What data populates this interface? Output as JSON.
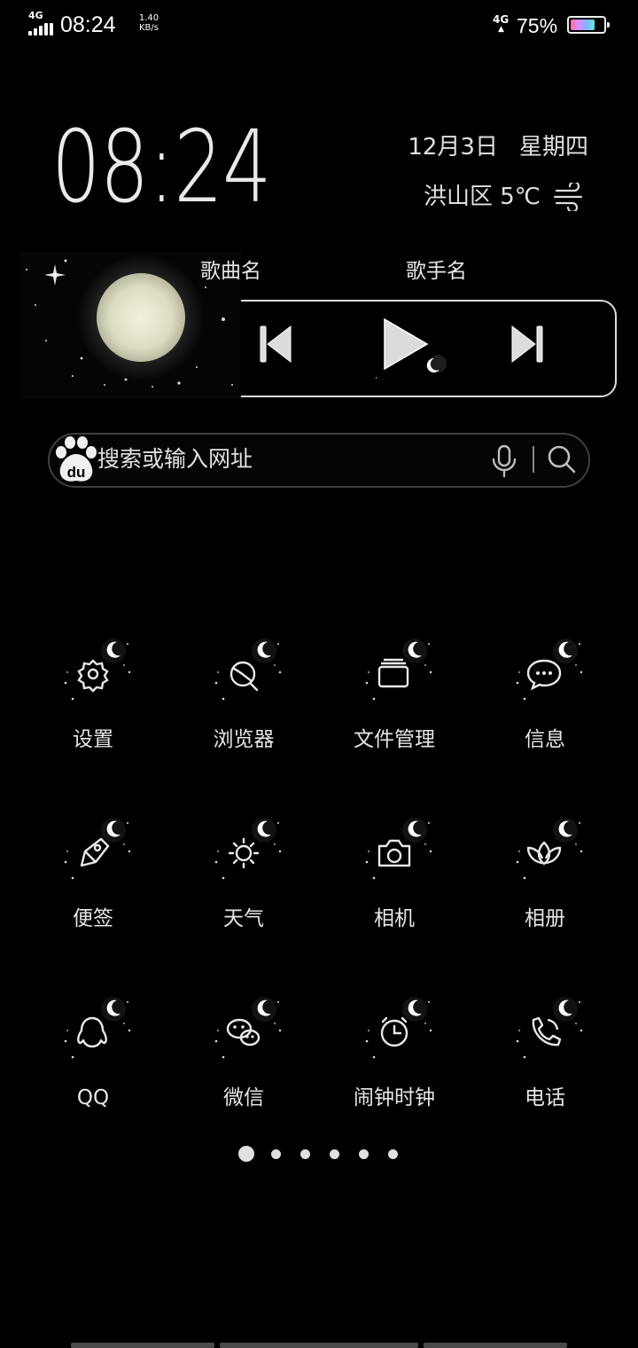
{
  "status_bar": {
    "network_left": "4G",
    "time": "08:24",
    "net_speed_value": "1.40",
    "net_speed_unit": "KB/s",
    "network_right": "4G",
    "battery_percent": "75%",
    "battery_level": 0.75
  },
  "clock_widget": {
    "time": "08:24",
    "date": "12月3日",
    "weekday": "星期四",
    "weather": "洪山区 5℃",
    "weather_icon": "wind-icon"
  },
  "music_widget": {
    "song_name": "歌曲名",
    "artist_name": "歌手名",
    "controls": [
      "previous-icon",
      "play-icon",
      "next-icon"
    ]
  },
  "search": {
    "placeholder": "搜索或输入网址",
    "engine_icon": "baidu-icon",
    "voice_icon": "mic-icon",
    "search_icon": "search-icon"
  },
  "apps": [
    {
      "label": "设置",
      "icon": "gear-icon"
    },
    {
      "label": "浏览器",
      "icon": "browser-icon"
    },
    {
      "label": "文件管理",
      "icon": "folder-icon"
    },
    {
      "label": "信息",
      "icon": "message-icon"
    },
    {
      "label": "便签",
      "icon": "note-icon"
    },
    {
      "label": "天气",
      "icon": "sun-icon"
    },
    {
      "label": "相机",
      "icon": "camera-icon"
    },
    {
      "label": "相册",
      "icon": "lotus-icon"
    },
    {
      "label": "QQ",
      "icon": "penguin-icon"
    },
    {
      "label": "微信",
      "icon": "wechat-icon"
    },
    {
      "label": "闹钟时钟",
      "icon": "clock-icon"
    },
    {
      "label": "电话",
      "icon": "phone-icon"
    }
  ],
  "page_indicator": {
    "total": 6,
    "current": 1
  },
  "colors": {
    "background": "#000000",
    "text": "#e6e6e6",
    "outline": "#dcdcdc"
  }
}
